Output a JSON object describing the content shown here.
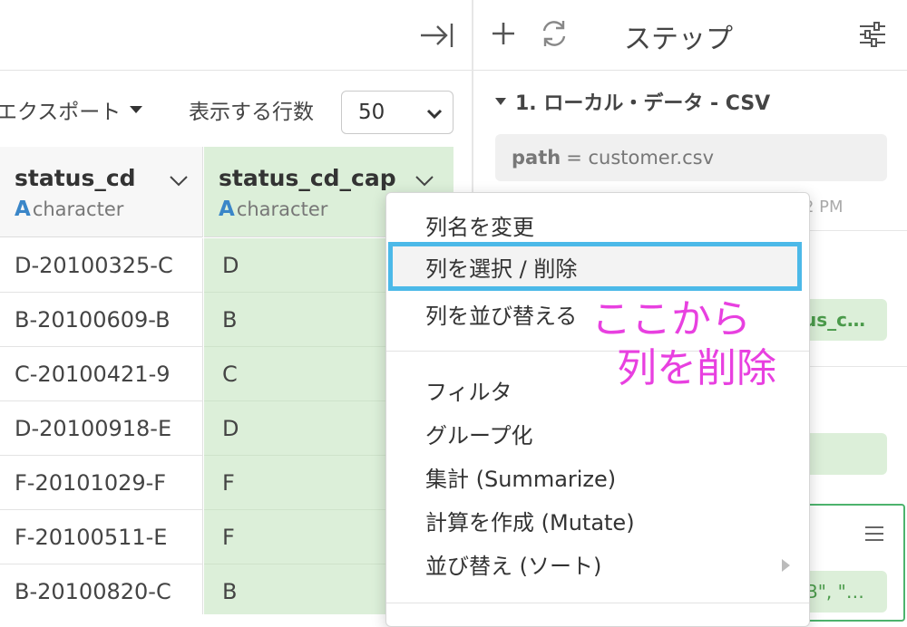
{
  "left_panel": {
    "toolbar": {
      "export_label": "エクスポート",
      "rows_label": "表示する行数",
      "rows_value": "50"
    },
    "columns": [
      {
        "name": "status_cd",
        "type_letter": "A",
        "type": "character"
      },
      {
        "name": "status_cd_cap",
        "type_letter": "A",
        "type": "character"
      }
    ],
    "rows": [
      [
        "D-20100325-C",
        "D"
      ],
      [
        "B-20100609-B",
        "B"
      ],
      [
        "C-20100421-9",
        "C"
      ],
      [
        "D-20100918-E",
        "D"
      ],
      [
        "F-20101029-F",
        "F"
      ],
      [
        "F-20100511-E",
        "F"
      ],
      [
        "B-20100820-C",
        "B"
      ]
    ]
  },
  "right_panel": {
    "title": "ステップ",
    "step1": {
      "label": "1. ローカル・データ - CSV",
      "path_key": "path",
      "path_value": "= customer.csv",
      "time_fragment": "2 PM"
    },
    "chip1_text": "us_c…",
    "chip3_text": "B\", \"…"
  },
  "context_menu": {
    "items": [
      {
        "label": "列名を変更"
      },
      {
        "label": "列を選択 / 削除",
        "highlighted": true
      },
      {
        "label": "列を並び替える"
      },
      {
        "label": "フィルタ"
      },
      {
        "label": "グループ化"
      },
      {
        "label": "集計 (Summarize)"
      },
      {
        "label": "計算を作成 (Mutate)"
      },
      {
        "label": "並び替え (ソート)"
      }
    ]
  },
  "annotation": {
    "line1": "ここから",
    "line2": "列を削除",
    "color": "#e840e0"
  },
  "colors": {
    "highlight_border": "#4cb9e8",
    "selected_column": "#dcefd9",
    "type_icon": "#3a86c8"
  }
}
